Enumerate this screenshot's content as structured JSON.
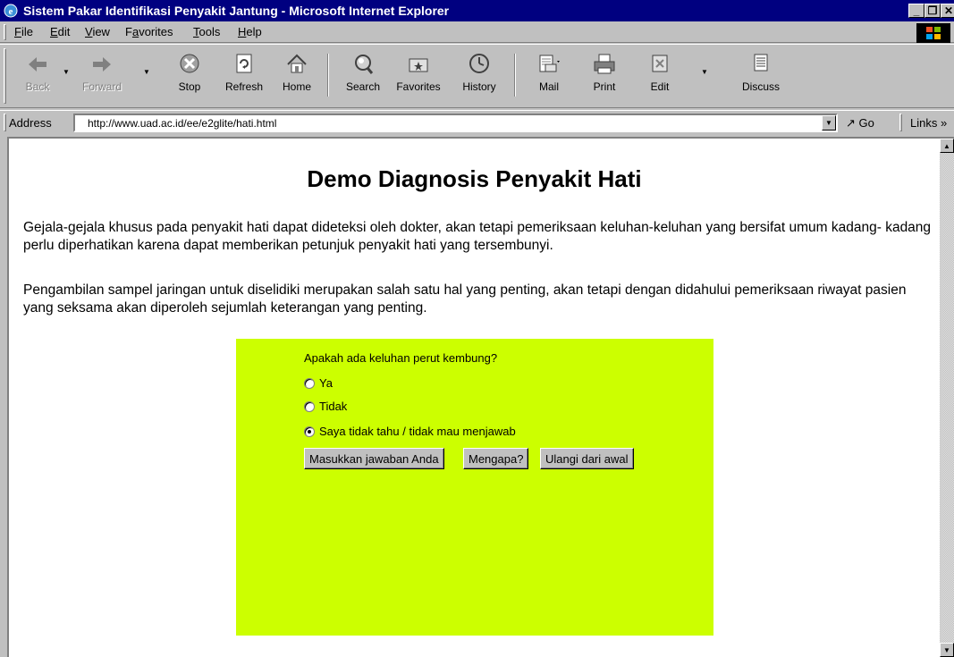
{
  "window": {
    "title": "Sistem Pakar Identifikasi Penyakit Jantung - Microsoft Internet Explorer",
    "minimize": "_",
    "maximize": "❐",
    "close": "✕"
  },
  "menu": {
    "file": "File",
    "edit": "Edit",
    "view": "View",
    "favorites": "Favorites",
    "tools": "Tools",
    "help": "Help"
  },
  "toolbar": {
    "back": "Back",
    "forward": "Forward",
    "stop": "Stop",
    "refresh": "Refresh",
    "home": "Home",
    "search": "Search",
    "favorites": "Favorites",
    "history": "History",
    "mail": "Mail",
    "print": "Print",
    "edit": "Edit",
    "discuss": "Discuss"
  },
  "address": {
    "label": "Address",
    "url": "http://www.uad.ac.id/ee/e2glite/hati.html",
    "go": "Go",
    "links": "Links »"
  },
  "page": {
    "title": "Demo Diagnosis Penyakit Hati",
    "paragraph1": "Gejala-gejala khusus pada penyakit hati dapat dideteksi oleh dokter, akan tetapi pemeriksaan keluhan-keluhan yang bersifat umum kadang- kadang perlu diperhatikan karena dapat memberikan petunjuk penyakit hati yang tersembunyi.",
    "paragraph2": "Pengambilan sampel jaringan untuk diselidiki merupakan salah satu hal yang penting, akan tetapi dengan didahului pemeriksaan riwayat pasien yang seksama akan diperoleh sejumlah keterangan yang penting."
  },
  "form": {
    "question": "Apakah ada keluhan perut kembung?",
    "options": [
      "Ya",
      "Tidak",
      "Saya tidak tahu / tidak mau menjawab"
    ],
    "selected_index": 2,
    "submit": "Masukkan jawaban Anda",
    "why": "Mengapa?",
    "restart": "Ulangi dari awal",
    "panel_color": "#ccff00"
  }
}
